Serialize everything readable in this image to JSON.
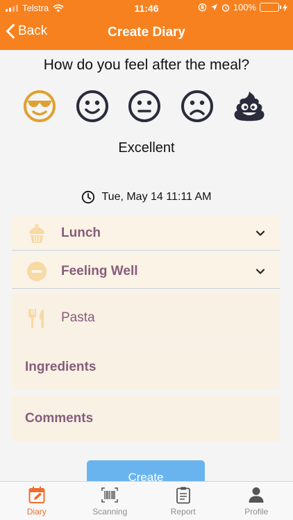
{
  "status_bar": {
    "carrier": "Telstra",
    "time": "11:46",
    "battery": "100%"
  },
  "header": {
    "back_label": "Back",
    "title": "Create Diary"
  },
  "question": "How do you feel after the meal?",
  "moods": [
    "sunglasses-face-icon",
    "smile-face-icon",
    "neutral-face-icon",
    "sad-face-icon",
    "poop-icon"
  ],
  "selected_mood": "Excellent",
  "datetime": "Tue, May 14 11:11 AM",
  "meal": {
    "label": "Lunch",
    "icon": "cupcake-icon"
  },
  "feeling": {
    "label": "Feeling Well",
    "icon": "minus-circle-icon"
  },
  "food": {
    "value": "Pasta",
    "icon": "fork-knife-icon"
  },
  "ingredients_label": "Ingredients",
  "comments_label": "Comments",
  "create_label": "Create",
  "tabs": [
    {
      "label": "Diary",
      "icon": "calendar-edit-icon",
      "active": true
    },
    {
      "label": "Scanning",
      "icon": "barcode-icon",
      "active": false
    },
    {
      "label": "Report",
      "icon": "clipboard-icon",
      "active": false
    },
    {
      "label": "Profile",
      "icon": "person-icon",
      "active": false
    }
  ],
  "colors": {
    "header": "#f7811f",
    "accent_label": "#855d7b",
    "row_background": "#fbf3e5",
    "button": "#69b4ee",
    "tab_active": "#ef6c2e",
    "selected_mood": "#e0a030",
    "mood_outline": "#2a2c3c"
  }
}
